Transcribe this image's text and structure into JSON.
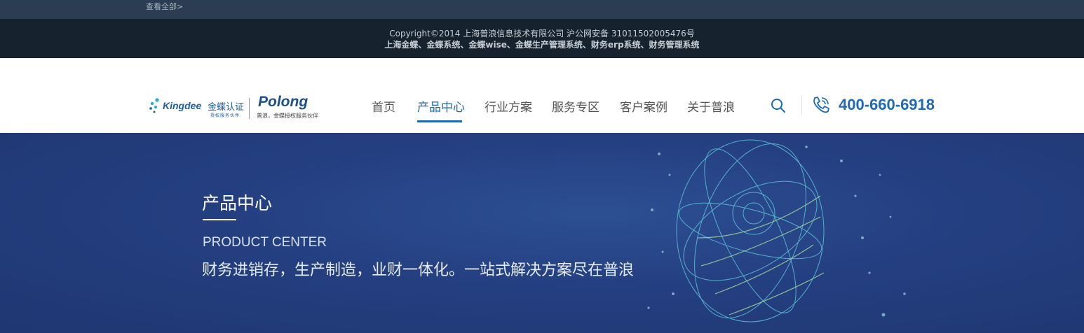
{
  "top_strip": {
    "view_all": "查看全部>"
  },
  "footer": {
    "copyright": "Copyright©2014 上海普浪信息技术有限公司 沪公网安备 31011502005476号",
    "keywords": "上海金蝶、金蝶系统、金蝶wise、金蝶生产管理系统、财务erp系统、财务管理系统"
  },
  "header": {
    "logo": {
      "kingdee": "Kingdee",
      "cert": "金蝶认证",
      "cert_sub": "授权服务伙伴",
      "polong": "Polong",
      "polong_sub": "普浪，金蝶授权服务伙伴"
    },
    "nav": [
      {
        "label": "首页",
        "active": false
      },
      {
        "label": "产品中心",
        "active": true
      },
      {
        "label": "行业方案",
        "active": false
      },
      {
        "label": "服务专区",
        "active": false
      },
      {
        "label": "客户案例",
        "active": false
      },
      {
        "label": "关于普浪",
        "active": false
      }
    ],
    "search_icon": "search-icon",
    "phone_icon": "phone-icon",
    "phone": "400-660-6918"
  },
  "banner": {
    "title": "产品中心",
    "subtitle_en": "PRODUCT CENTER",
    "tagline": "财务进销存，生产制造，业财一体化。一站式解决方案尽在普浪"
  },
  "colors": {
    "accent": "#1e6ab8",
    "banner_bg": "#243f80",
    "footer_bg": "#16222e"
  }
}
